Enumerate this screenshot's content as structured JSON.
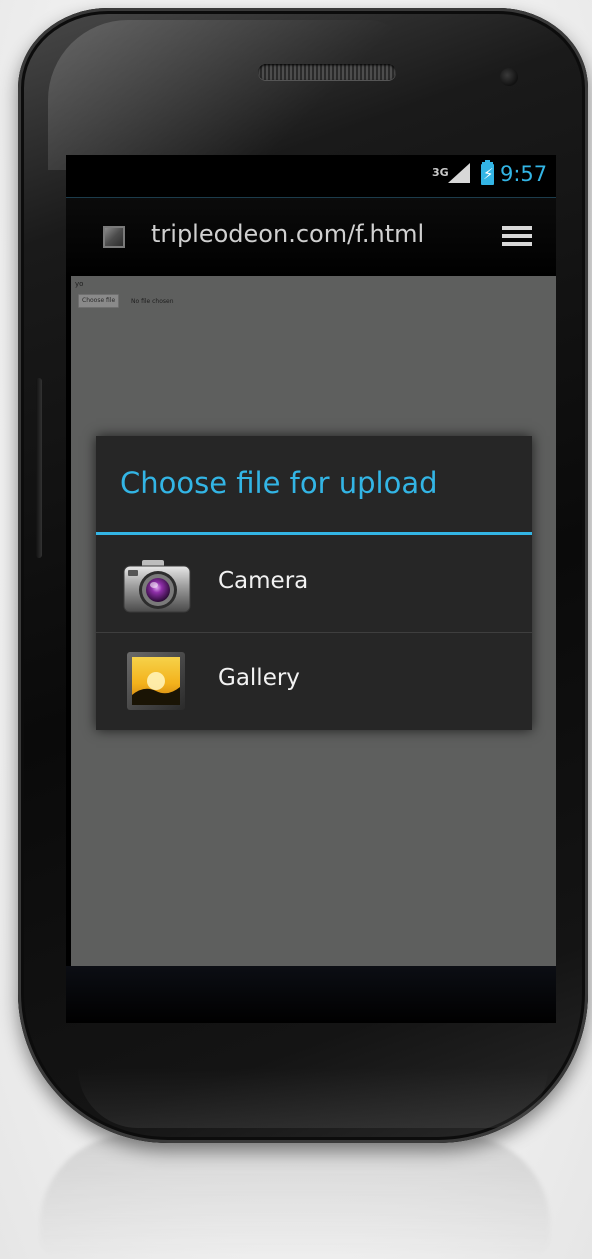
{
  "status_bar": {
    "network": "3G",
    "time": "9:57",
    "signal_icon": "cell-signal-icon",
    "battery_icon": "battery-charging-icon",
    "accent_color": "#33b5e5"
  },
  "browser": {
    "url": "tripleodeon.com/f.html",
    "favicon_icon": "site-favicon",
    "tabs_icon": "tabs-stack-icon"
  },
  "page": {
    "text": "yo",
    "file_button_label": "Choose file",
    "file_status": "No file chosen"
  },
  "dialog": {
    "title": "Choose file for upload",
    "options": [
      {
        "label": "Camera",
        "icon": "camera-icon"
      },
      {
        "label": "Gallery",
        "icon": "gallery-icon"
      }
    ]
  }
}
